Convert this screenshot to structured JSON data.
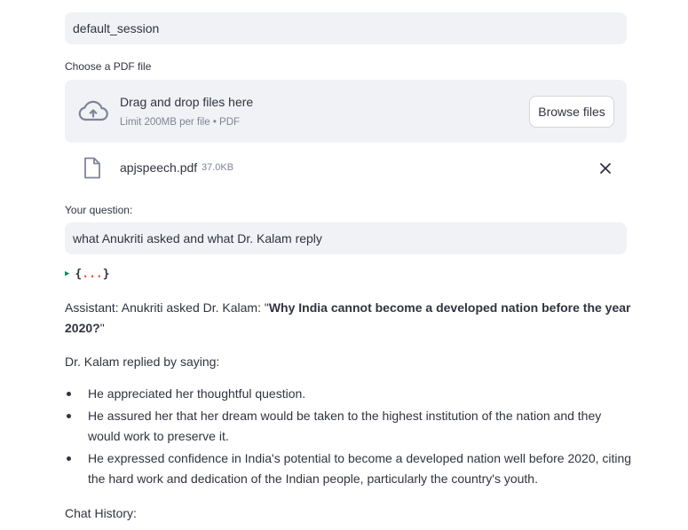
{
  "session": {
    "value": "default_session"
  },
  "uploader": {
    "label": "Choose a PDF file",
    "drop_title": "Drag and drop files here",
    "limit_text": "Limit 200MB per file • PDF",
    "browse_label": "Browse files",
    "icon": "cloud-upload-icon"
  },
  "uploaded_file": {
    "name": "apjspeech.pdf",
    "size": "37.0KB",
    "icon": "file-icon",
    "remove_icon": "close-icon"
  },
  "question": {
    "label": "Your question:",
    "value": "what Anukriti asked and what Dr. Kalam reply"
  },
  "json_viewer": {
    "open": "{",
    "dots": "...",
    "close": "}"
  },
  "answer": {
    "prefix": "Assistant: Anukriti asked Dr. Kalam: \"",
    "bold": "Why India cannot become a developed nation before the year 2020?",
    "suffix": "\"",
    "reply_intro": "Dr. Kalam replied by saying:",
    "bullets": [
      "He appreciated her thoughtful question.",
      "He assured her that her dream would be taken to the highest institution of the nation and they would work to preserve it.",
      "He expressed confidence in India's potential to become a developed nation well before 2020, citing the hard work and dedication of the Indian people, particularly the country's youth."
    ]
  },
  "chat_history": {
    "label": "Chat History:"
  },
  "colors": {
    "input_bg": "#f0f2f6",
    "text": "#31333f",
    "muted": "#808495",
    "json_caret": "#0b8a5a",
    "json_dots": "#e8563d"
  }
}
